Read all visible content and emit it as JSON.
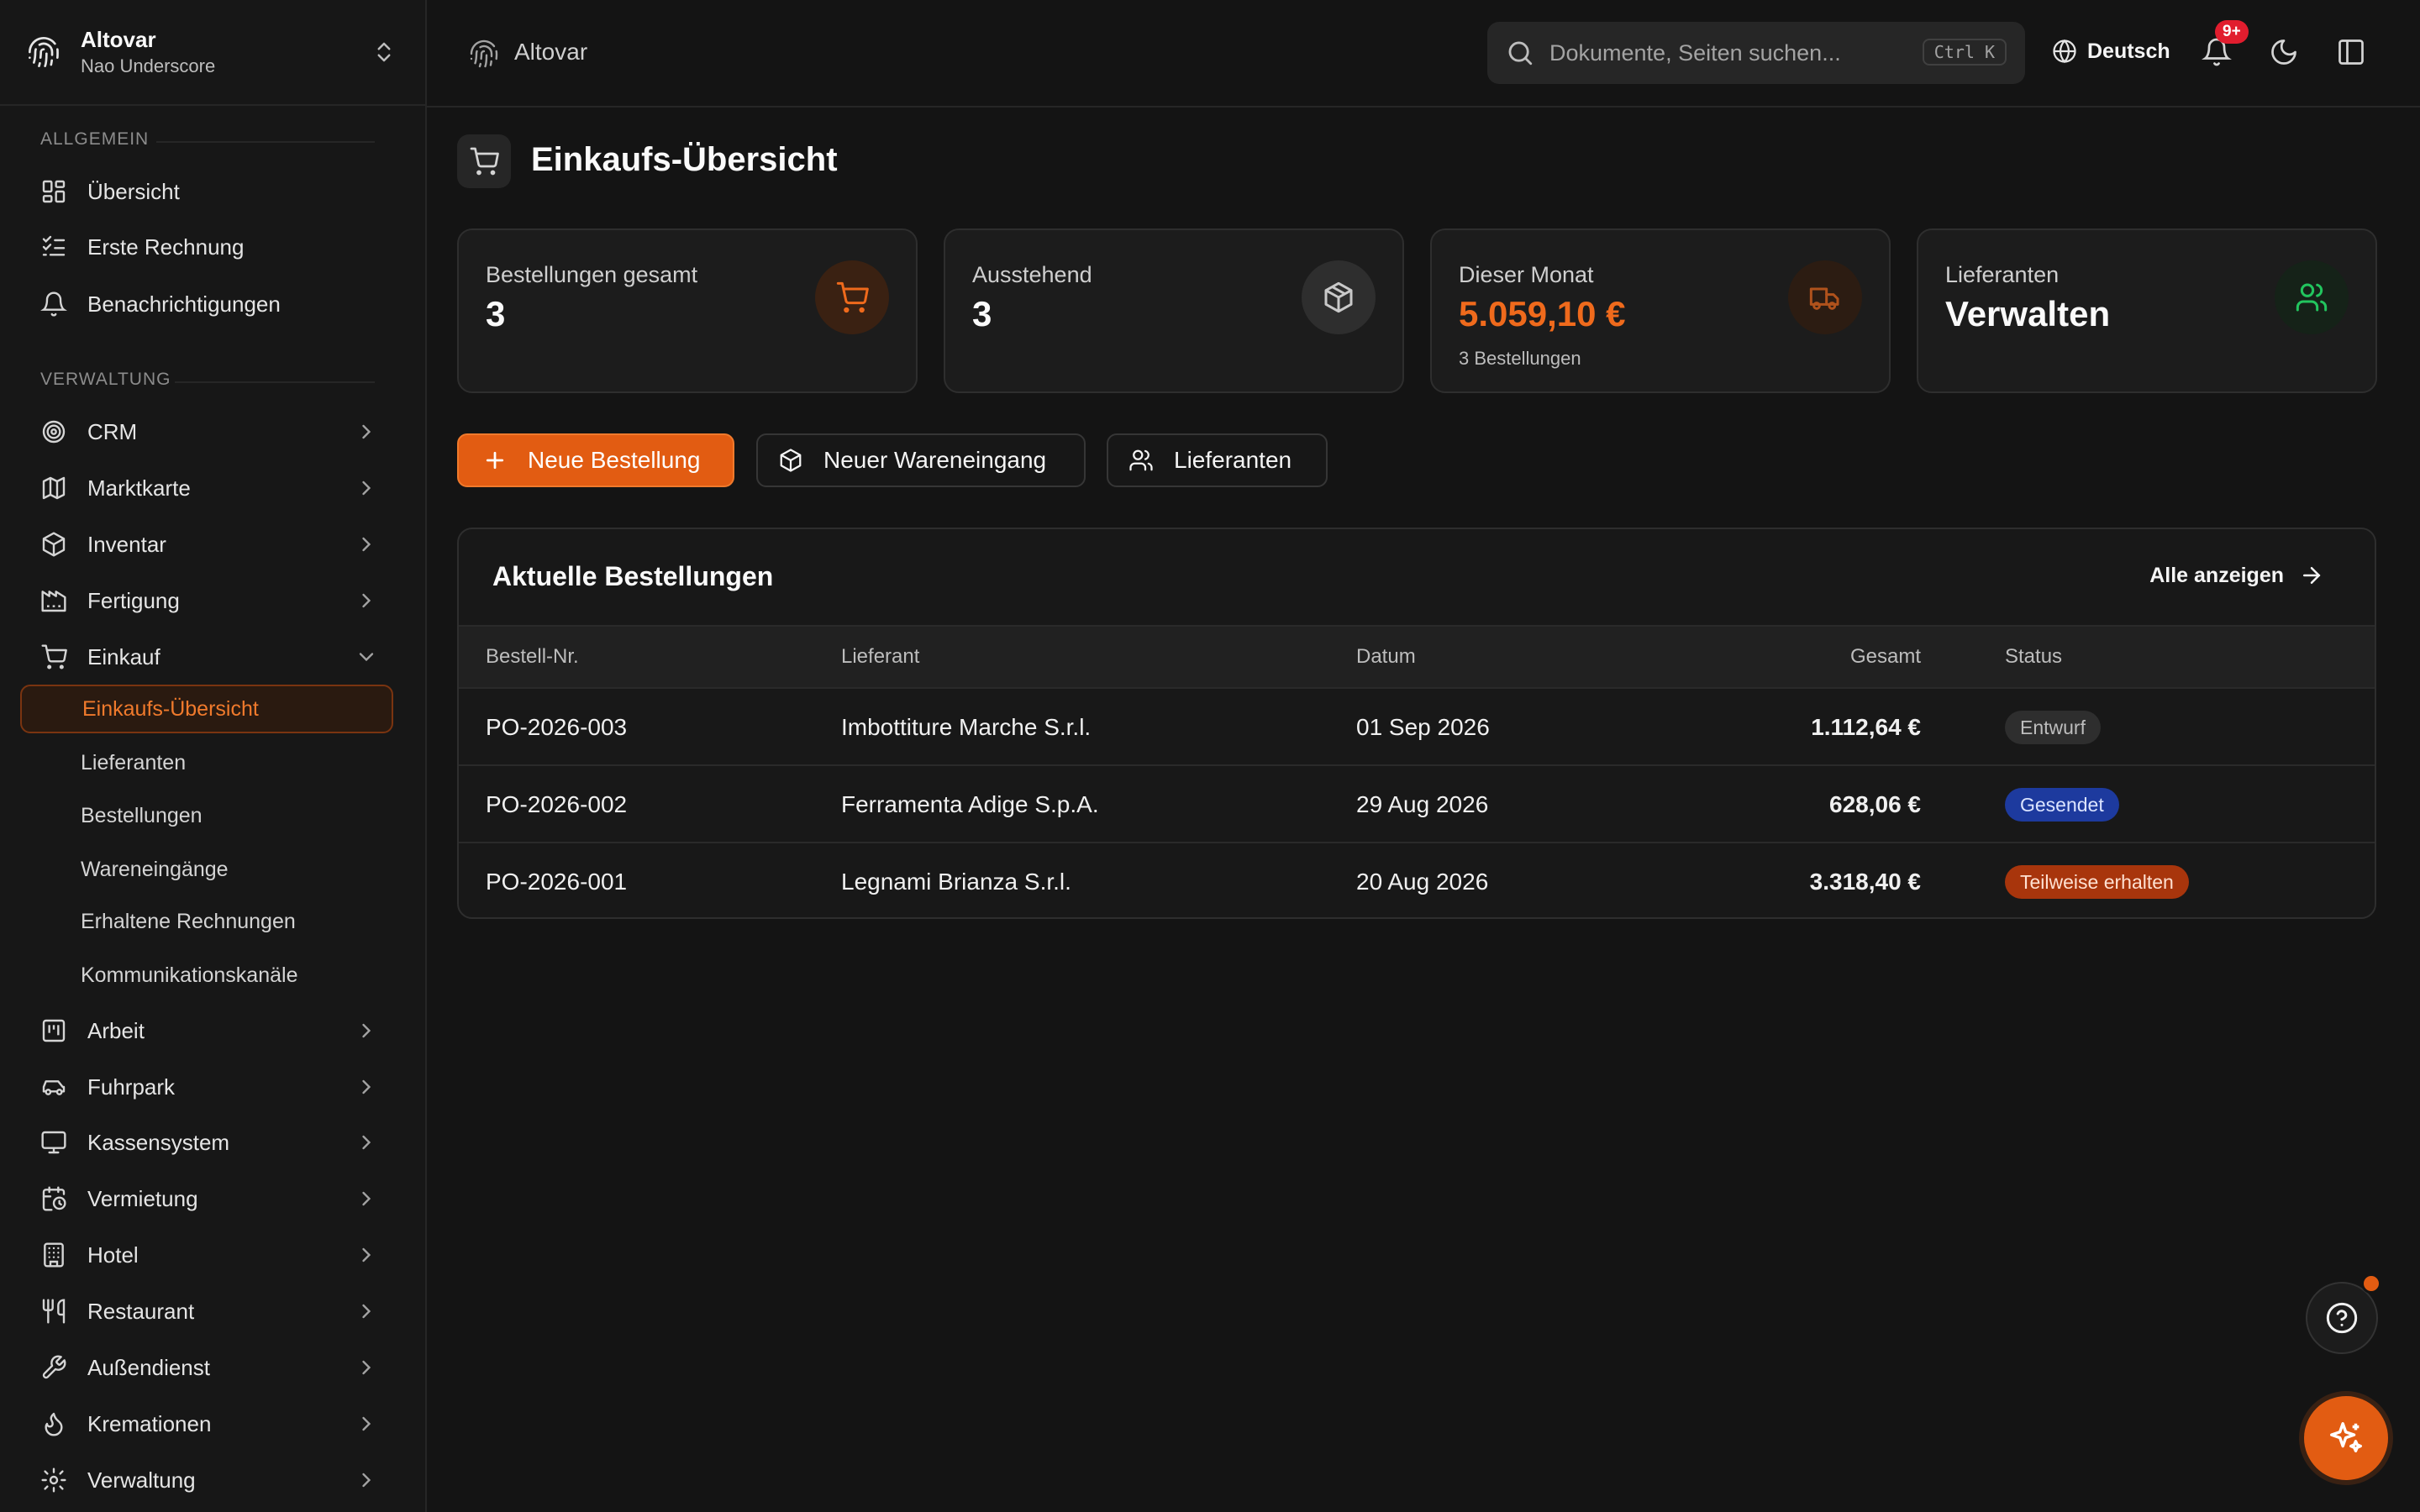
{
  "colors": {
    "accent": "#e25c12",
    "success": "#22c55e",
    "draft": "#2e2e2e",
    "sent": "#1d3a9e",
    "partial": "#a8350c"
  },
  "workspace": {
    "name": "Altovar",
    "user": "Nao Underscore"
  },
  "sidebar": {
    "section_general": "ALLGEMEIN",
    "general_items": [
      {
        "label": "Übersicht",
        "icon": "dashboard-icon"
      },
      {
        "label": "Erste Rechnung",
        "icon": "checklist-icon"
      },
      {
        "label": "Benachrichtigungen",
        "icon": "bell-icon"
      }
    ],
    "section_admin": "VERWALTUNG",
    "admin_items": [
      {
        "label": "CRM",
        "icon": "target-icon"
      },
      {
        "label": "Marktkarte",
        "icon": "map-icon"
      },
      {
        "label": "Inventar",
        "icon": "box-icon"
      },
      {
        "label": "Fertigung",
        "icon": "factory-icon"
      },
      {
        "label": "Einkauf",
        "icon": "cart-icon",
        "expanded": true
      },
      {
        "label": "Arbeit",
        "icon": "kanban-icon"
      },
      {
        "label": "Fuhrpark",
        "icon": "car-icon"
      },
      {
        "label": "Kassensystem",
        "icon": "monitor-icon"
      },
      {
        "label": "Vermietung",
        "icon": "calendar-clock-icon"
      },
      {
        "label": "Hotel",
        "icon": "building-icon"
      },
      {
        "label": "Restaurant",
        "icon": "utensils-icon"
      },
      {
        "label": "Außendienst",
        "icon": "wrench-icon"
      },
      {
        "label": "Kremationen",
        "icon": "flame-icon"
      },
      {
        "label": "Verwaltung",
        "icon": "settings-icon"
      }
    ],
    "purchase_sub": [
      {
        "label": "Einkaufs-Übersicht",
        "active": true
      },
      {
        "label": "Lieferanten"
      },
      {
        "label": "Bestellungen"
      },
      {
        "label": "Wareneingänge"
      },
      {
        "label": "Erhaltene Rechnungen"
      },
      {
        "label": "Kommunikationskanäle"
      }
    ]
  },
  "topbar": {
    "title": "Altovar",
    "search_placeholder": "Dokumente, Seiten suchen...",
    "shortcut": "Ctrl K",
    "language": "Deutsch",
    "notif_badge": "9+"
  },
  "page": {
    "title": "Einkaufs-Übersicht"
  },
  "cards": [
    {
      "label": "Bestellungen gesamt",
      "value": "3",
      "sub": "",
      "icon": "cart-icon"
    },
    {
      "label": "Ausstehend",
      "value": "3",
      "sub": "",
      "icon": "package-icon"
    },
    {
      "label": "Dieser Monat",
      "value": "5.059,10 €",
      "sub": "3 Bestellungen",
      "icon": "truck-icon"
    },
    {
      "label": "Lieferanten",
      "value": "Verwalten",
      "sub": "",
      "icon": "users-icon"
    }
  ],
  "actions": {
    "new_order": "Neue Bestellung",
    "new_receipt": "Neuer Wareneingang",
    "suppliers": "Lieferanten"
  },
  "orders": {
    "title": "Aktuelle Bestellungen",
    "view_all": "Alle anzeigen",
    "columns": [
      "Bestell-Nr.",
      "Lieferant",
      "Datum",
      "Gesamt",
      "Status"
    ],
    "rows": [
      {
        "id": "PO-2026-003",
        "supplier": "Imbottiture Marche S.r.l.",
        "date": "01 Sep 2026",
        "total": "1.112,64 €",
        "status": "Entwurf"
      },
      {
        "id": "PO-2026-002",
        "supplier": "Ferramenta Adige S.p.A.",
        "date": "29 Aug 2026",
        "total": "628,06 €",
        "status": "Gesendet"
      },
      {
        "id": "PO-2026-001",
        "supplier": "Legnami Brianza S.r.l.",
        "date": "20 Aug 2026",
        "total": "3.318,40 €",
        "status": "Teilweise erhalten"
      }
    ]
  }
}
